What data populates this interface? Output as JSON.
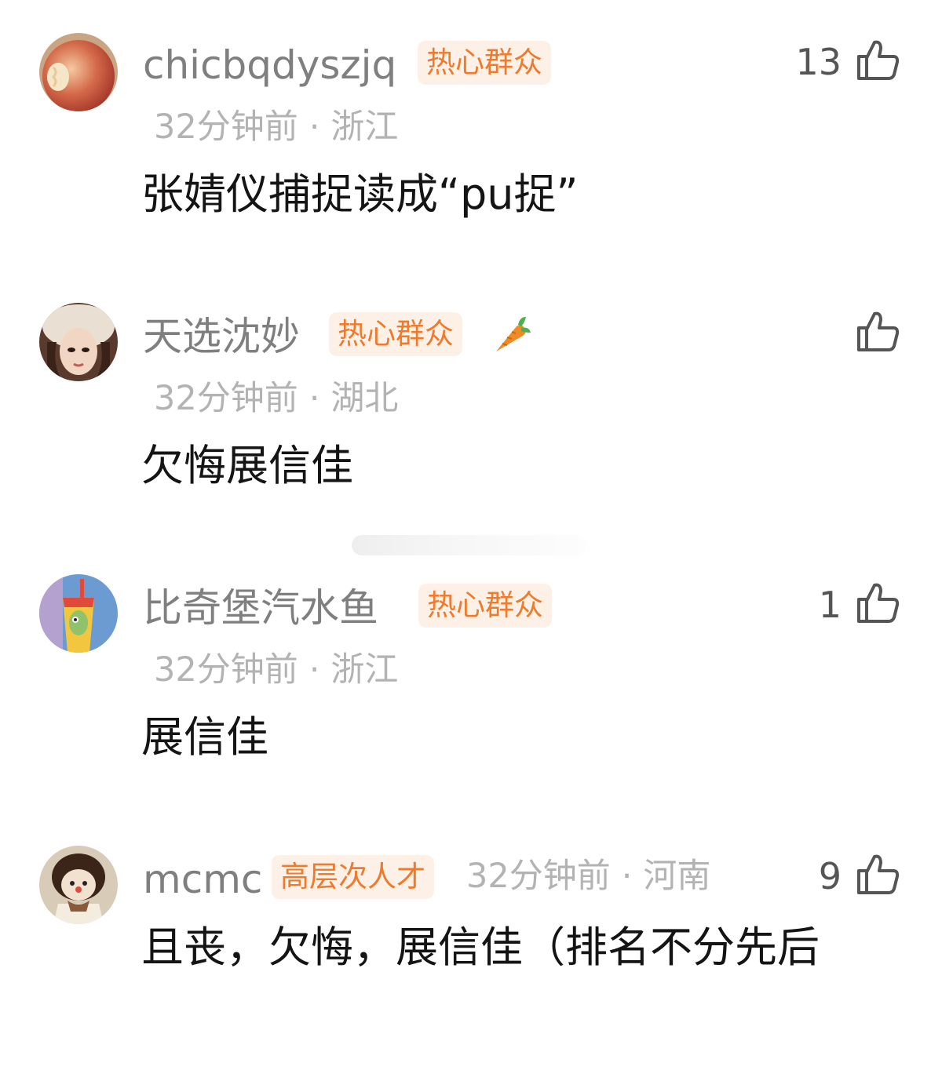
{
  "comments": [
    {
      "username": "chicbqdyszjq",
      "badge": "热心群众",
      "time": "32分钟前",
      "location": "浙江",
      "text": "张婧仪捕捉读成“pu捉”",
      "likes": "13",
      "avatar_icon": "apple-avatar"
    },
    {
      "username": "天选沈妙",
      "badge": "热心群众",
      "time": "32分钟前",
      "location": "湖北",
      "text": "欠悔展信佳",
      "likes": "",
      "avatar_icon": "girl-fur-hat-avatar",
      "sticker_icon": "carrot-icon"
    },
    {
      "username": "比奇堡汽水鱼",
      "badge": "热心群众",
      "time": "32分钟前",
      "location": "浙江",
      "text": "展信佳",
      "likes": "1",
      "avatar_icon": "soda-cup-cartoon-avatar"
    },
    {
      "username": "mcmc",
      "badge": "高层次人才",
      "time": "32分钟前",
      "location": "河南",
      "text": "且丧，欠悔，展信佳（排名不分先后",
      "likes": "9",
      "avatar_icon": "doll-avatar"
    }
  ],
  "icons": {
    "like": "thumbs-up-icon"
  },
  "colors": {
    "badge_text": "#f07a2c",
    "badge_bg": "#fdf1e7",
    "username": "#7f7f7f",
    "meta": "#b3b3b3",
    "body_text": "#141414"
  }
}
